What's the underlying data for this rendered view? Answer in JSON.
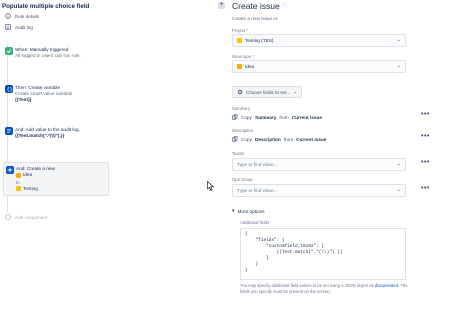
{
  "rule": {
    "title": "Populate multiple choice field",
    "nav": [
      {
        "label": "Rule details",
        "icon": "info-icon"
      },
      {
        "label": "Audit log",
        "icon": "list-icon"
      }
    ]
  },
  "steps": [
    {
      "title": "When: Manually triggered",
      "sub": "All logged in users can run rule."
    },
    {
      "title": "Then: Create variable",
      "sub": "Create smart value variable",
      "bold": "{{Test}}"
    },
    {
      "title": "And: Add value to the audit log.",
      "bold": "{{Test.match(\".*(\\\\)\").}}"
    },
    {
      "title": "And: Create a new",
      "issue_type": "Idea",
      "in_label": "in",
      "project": "Testing"
    }
  ],
  "add_component": "Add component",
  "panel": {
    "title": "Create issue",
    "description": "Create a new issue in:",
    "project_label": "Project *",
    "project_value": "Testing (TES)",
    "issue_type_label": "Issue type *",
    "issue_type_value": "Idea",
    "choose_fields": "Choose fields to set...",
    "summary_label": "Summary",
    "summary_copy": "Copy",
    "summary_field": "Summary",
    "summary_from": "from",
    "summary_source": "Current issue",
    "description_label": "Description",
    "description_copy": "Copy",
    "description_field": "Description",
    "description_from": "from",
    "description_source": "Current issue",
    "teams_label": "Teams",
    "teams_placeholder": "Type to find value...",
    "ops_label": "Ops Group",
    "ops_placeholder": "Type to find value...",
    "more_options": "More options",
    "additional_fields_label": "Additional fields",
    "additional_fields_code": "{\n    \"fields\": {\n        \"customfield_10182\": [\n            {{Test.match(\".*(\\\\)\").}}\n        ]\n    }\n}",
    "help_text": "You may specify additional field values to be set using a JSON object as",
    "help_link": "documented",
    "help_text_after": ". The fields you specify must be present on the screen."
  },
  "colors": {
    "trigger": "#36b37e",
    "action": "#0052cc",
    "idea": "#ffab00",
    "project": "#ffc400"
  }
}
